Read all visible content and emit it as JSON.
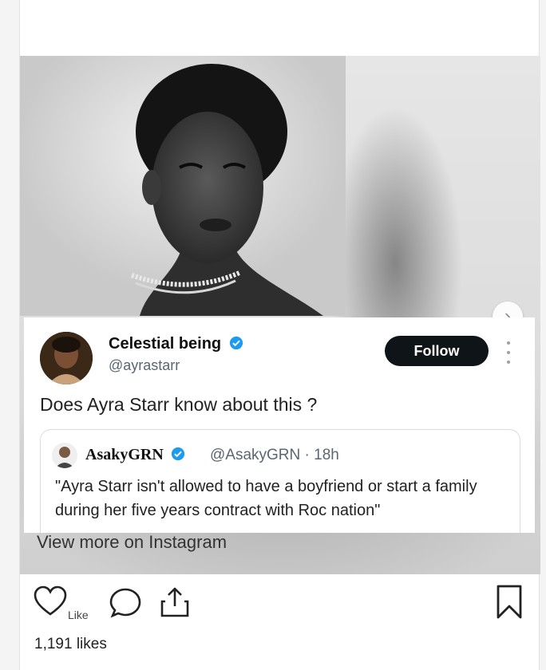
{
  "tweet": {
    "display_name": "Celestial being",
    "handle": "@ayrastarr",
    "follow_label": "Follow",
    "text": "Does Ayra Starr know about this ?",
    "quote": {
      "name": "AsakyGRN",
      "handle_time": "@AsakyGRN · 18h",
      "text": "\"Ayra Starr isn't allowed to have a boyfriend or start a family during her five years contract with Roc nation\""
    }
  },
  "post": {
    "view_more_label": "View more on Instagram",
    "like_label": "Like",
    "likes_count": "1,191 likes"
  },
  "colors": {
    "verified": "#1d9bf0",
    "follow_bg": "#0f1419"
  },
  "icons": [
    "chevron-right-icon",
    "verified-badge-icon",
    "more-dots-icon",
    "heart-icon",
    "comment-icon",
    "share-icon",
    "bookmark-icon"
  ]
}
